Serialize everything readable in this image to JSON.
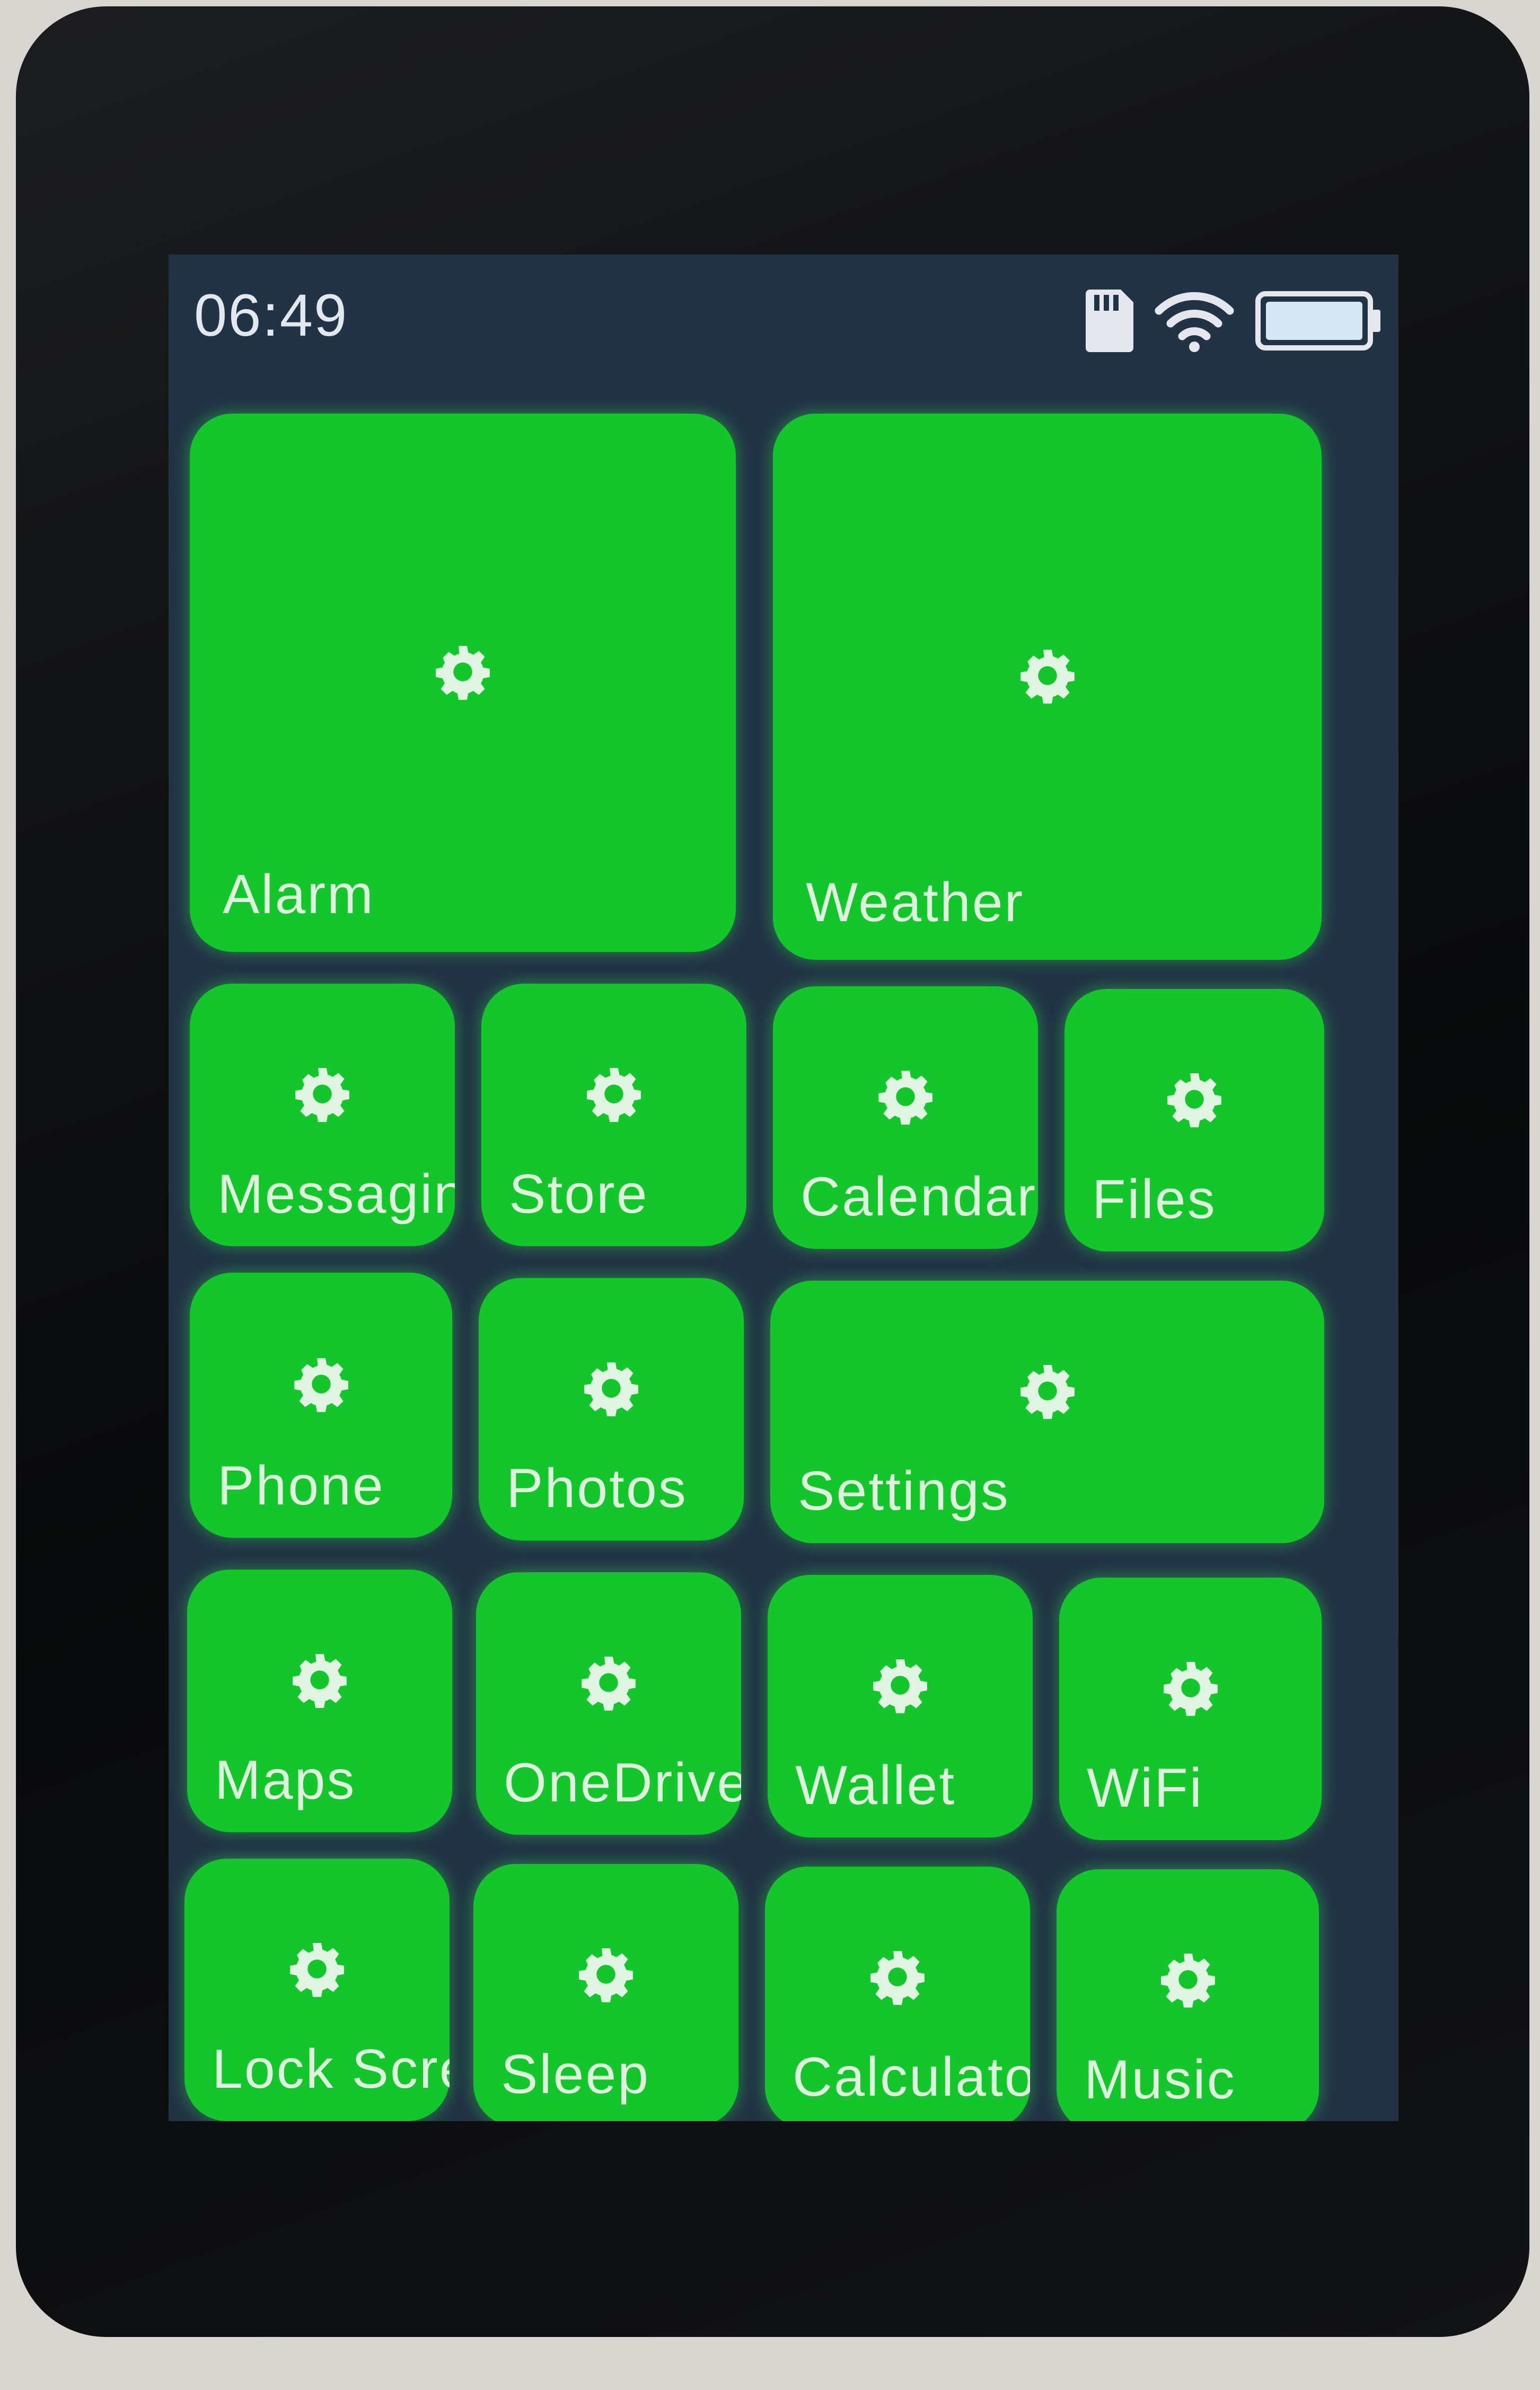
{
  "status_bar": {
    "time": "06:49",
    "icons": [
      "sd-card-icon",
      "wifi-icon",
      "battery-icon"
    ]
  },
  "colors": {
    "tile": "#14c62c",
    "screen": "#223346",
    "bezel": "#0b0c0e",
    "label": "#dcf3dc"
  },
  "tiles": [
    {
      "label": "Alarm",
      "icon": "gear-icon"
    },
    {
      "label": "Weather",
      "icon": "gear-icon"
    },
    {
      "label": "Messaging",
      "icon": "gear-icon"
    },
    {
      "label": "Store",
      "icon": "gear-icon"
    },
    {
      "label": "Calendar",
      "icon": "gear-icon"
    },
    {
      "label": "Files",
      "icon": "gear-icon"
    },
    {
      "label": "Phone",
      "icon": "gear-icon"
    },
    {
      "label": "Photos",
      "icon": "gear-icon"
    },
    {
      "label": "Settings",
      "icon": "gear-icon"
    },
    {
      "label": "Maps",
      "icon": "gear-icon"
    },
    {
      "label": "OneDrive",
      "icon": "gear-icon"
    },
    {
      "label": "Wallet",
      "icon": "gear-icon"
    },
    {
      "label": "WiFi",
      "icon": "gear-icon"
    },
    {
      "label": "Lock Screen",
      "icon": "gear-icon"
    },
    {
      "label": "Sleep",
      "icon": "gear-icon"
    },
    {
      "label": "Calculator",
      "icon": "gear-icon"
    },
    {
      "label": "Music",
      "icon": "gear-icon"
    }
  ]
}
